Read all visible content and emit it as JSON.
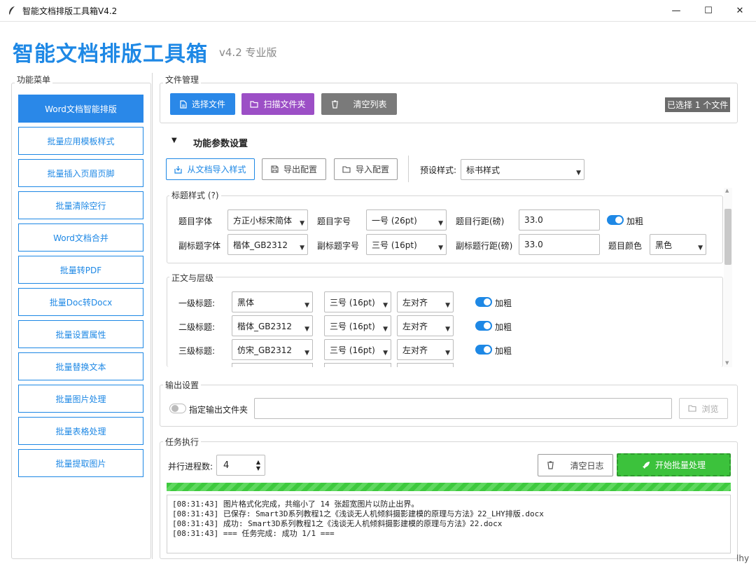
{
  "window": {
    "title": "智能文档排版工具箱V4.2",
    "min": "—",
    "max": "☐",
    "close": "✕"
  },
  "header": {
    "title": "智能文档排版工具箱",
    "subtitle": "v4.2 专业版"
  },
  "menu": {
    "legend": "功能菜单",
    "items": [
      "Word文档智能排版",
      "批量应用模板样式",
      "批量插入页眉页脚",
      "批量清除空行",
      "Word文档合并",
      "批量转PDF",
      "批量Doc转Docx",
      "批量设置属性",
      "批量替换文本",
      "批量图片处理",
      "批量表格处理",
      "批量提取图片"
    ]
  },
  "file_mgmt": {
    "legend": "文件管理",
    "select_btn": "选择文件",
    "scan_btn": "扫描文件夹",
    "clear_btn": "清空列表",
    "status": "已选择 1 个文件"
  },
  "params": {
    "head": "功能参数设置",
    "import_style_btn": "从文档导入样式",
    "export_cfg_btn": "导出配置",
    "import_cfg_btn": "导入配置",
    "preset_label": "预设样式:",
    "preset_value": "标书样式"
  },
  "title_style": {
    "legend": "标题样式 (?)",
    "font_label": "题目字体",
    "font_value": "方正小标宋简体",
    "size_label": "题目字号",
    "size_value": "一号 (26pt)",
    "spacing_label": "题目行距(磅)",
    "spacing_value": "33.0",
    "bold_label": "加粗",
    "sub_font_label": "副标题字体",
    "sub_font_value": "楷体_GB2312",
    "sub_size_label": "副标题字号",
    "sub_size_value": "三号 (16pt)",
    "sub_spacing_label": "副标题行距(磅)",
    "sub_spacing_value": "33.0",
    "color_label": "题目颜色",
    "color_value": "黑色"
  },
  "body_levels": {
    "legend": "正文与层级",
    "rows": [
      {
        "label": "一级标题:",
        "font": "黑体",
        "size": "三号 (16pt)",
        "align": "左对齐",
        "bold": "加粗"
      },
      {
        "label": "二级标题:",
        "font": "楷体_GB2312",
        "size": "三号 (16pt)",
        "align": "左对齐",
        "bold": "加粗"
      },
      {
        "label": "三级标题:",
        "font": "仿宋_GB2312",
        "size": "三号 (16pt)",
        "align": "左对齐",
        "bold": "加粗"
      }
    ]
  },
  "output": {
    "legend": "输出设置",
    "toggle_label": "指定输出文件夹",
    "path_value": "",
    "browse_btn": "浏览"
  },
  "task": {
    "legend": "任务执行",
    "parallel_label": "并行进程数:",
    "parallel_value": "4",
    "clear_log_btn": "清空日志",
    "start_btn": "开始批量处理",
    "progress": 1.0,
    "log": [
      "[08:31:43] 图片格式化完成，共缩小了 14 张超宽图片以防止出界。",
      "[08:31:43] 已保存: Smart3D系列教程1之《浅谈无人机倾斜摄影建模的原理与方法》22_LHY排版.docx",
      "[08:31:43] 成功: Smart3D系列教程1之《浅谈无人机倾斜摄影建模的原理与方法》22.docx",
      "[08:31:43] === 任务完成: 成功 1/1 ==="
    ]
  },
  "footer": "lhy",
  "colors": {
    "accent": "#2a88e8",
    "purple": "#9c4fc6",
    "grey": "#7a7a7a",
    "green": "#3cc23c"
  }
}
